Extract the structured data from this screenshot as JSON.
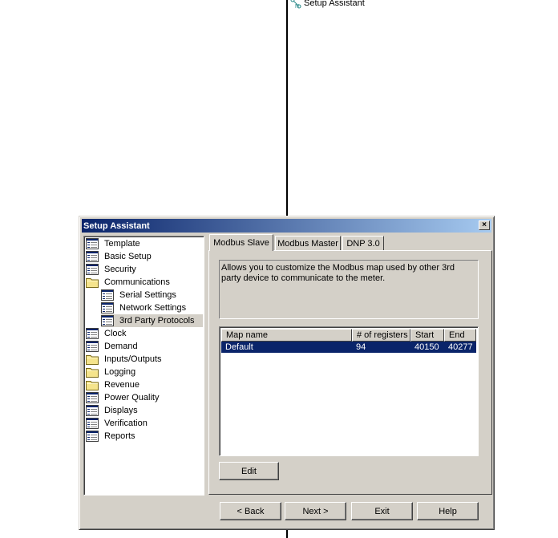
{
  "background_label": {
    "text": "Setup Assistant",
    "icon": "network-icon"
  },
  "dialog": {
    "title": "Setup Assistant",
    "close_label": "×"
  },
  "tree": {
    "items": [
      {
        "label": "Template",
        "icon": "settings-page-icon",
        "level": 0
      },
      {
        "label": "Basic Setup",
        "icon": "settings-page-icon",
        "level": 0
      },
      {
        "label": "Security",
        "icon": "settings-page-icon",
        "level": 0
      },
      {
        "label": "Communications",
        "icon": "folder-icon",
        "level": 0
      },
      {
        "label": "Serial Settings",
        "icon": "settings-page-icon",
        "level": 1
      },
      {
        "label": "Network Settings",
        "icon": "settings-page-icon",
        "level": 1
      },
      {
        "label": "3rd Party Protocols",
        "icon": "settings-page-icon",
        "level": 1,
        "selected": true
      },
      {
        "label": "Clock",
        "icon": "settings-page-icon",
        "level": 0
      },
      {
        "label": "Demand",
        "icon": "settings-page-icon",
        "level": 0
      },
      {
        "label": "Inputs/Outputs",
        "icon": "folder-icon",
        "level": 0
      },
      {
        "label": "Logging",
        "icon": "folder-icon",
        "level": 0
      },
      {
        "label": "Revenue",
        "icon": "folder-icon",
        "level": 0
      },
      {
        "label": "Power Quality",
        "icon": "settings-page-icon",
        "level": 0
      },
      {
        "label": "Displays",
        "icon": "settings-page-icon",
        "level": 0
      },
      {
        "label": "Verification",
        "icon": "settings-page-icon",
        "level": 0
      },
      {
        "label": "Reports",
        "icon": "settings-page-icon",
        "level": 0
      }
    ]
  },
  "tabs": [
    {
      "label": "Modbus Slave",
      "active": true
    },
    {
      "label": "Modbus Master",
      "active": false
    },
    {
      "label": "DNP 3.0",
      "active": false
    }
  ],
  "description": "Allows you to customize the Modbus map used by other 3rd party device to communicate to the meter.",
  "map_table": {
    "columns": [
      "Map name",
      "# of registers",
      "Start",
      "End"
    ],
    "rows": [
      [
        "Default",
        "94",
        "40150",
        "40277"
      ]
    ],
    "selected_row": 0
  },
  "buttons": {
    "edit": "Edit",
    "back": "< Back",
    "next": "Next >",
    "exit": "Exit",
    "help": "Help"
  },
  "colors": {
    "title_gradient_start": "#0a246a",
    "title_gradient_end": "#a6caf0",
    "selection": "#0a246a",
    "face": "#d4d0c8"
  }
}
